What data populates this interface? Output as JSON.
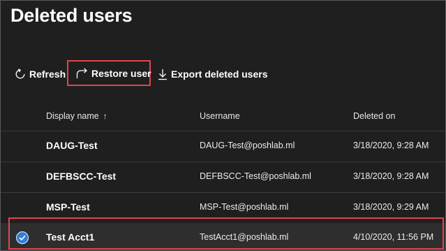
{
  "page": {
    "title": "Deleted users"
  },
  "toolbar": {
    "refresh_label": "Refresh",
    "restore_label": "Restore user",
    "export_label": "Export deleted users"
  },
  "table": {
    "columns": {
      "display_name": "Display name",
      "sort_indicator": "↑",
      "username": "Username",
      "deleted_on": "Deleted on"
    },
    "rows": [
      {
        "display_name": "DAUG-Test",
        "username": "DAUG-Test@poshlab.ml",
        "deleted_on": "3/18/2020, 9:28 AM",
        "selected": false
      },
      {
        "display_name": "DEFBSCC-Test",
        "username": "DEFBSCC-Test@poshlab.ml",
        "deleted_on": "3/18/2020, 9:28 AM",
        "selected": false
      },
      {
        "display_name": "MSP-Test",
        "username": "MSP-Test@poshlab.ml",
        "deleted_on": "3/18/2020, 9:29 AM",
        "selected": false
      },
      {
        "display_name": "Test Acct1",
        "username": "TestAcct1@poshlab.ml",
        "deleted_on": "4/10/2020, 11:56 PM",
        "selected": true
      }
    ]
  },
  "colors": {
    "background": "#1f1f1f",
    "highlight_outline": "#e0464b",
    "selected_row": "#2e2e2e",
    "checkmark": "#2f7fd6"
  },
  "icons": {
    "refresh": "refresh-icon",
    "restore": "restore-icon",
    "export": "download-icon",
    "selected": "checkmark-circle-icon"
  }
}
